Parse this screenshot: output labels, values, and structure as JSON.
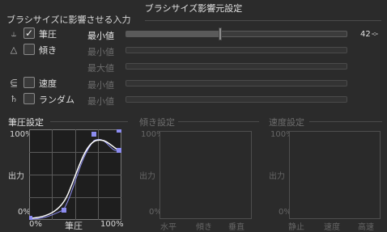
{
  "window_title": "ブラシサイズ影響元設定",
  "section_title": "ブラシサイズに影響させる入力",
  "rows": [
    {
      "icon": "⥿",
      "label": "筆圧",
      "checked": true,
      "param": "最小値",
      "value": "42"
    },
    {
      "icon": "△",
      "label": "傾き",
      "checked": false,
      "param": "最小値"
    },
    {
      "param": "最大値"
    },
    {
      "icon": "⋸",
      "label": "速度",
      "checked": false,
      "param": "最小値"
    },
    {
      "icon": "♄",
      "label": "ランダム",
      "checked": false,
      "param": "最小値"
    }
  ],
  "pressure_panel": {
    "title": "筆圧設定",
    "y_top": "100%",
    "y_mid": "出力",
    "y_bottom": "0%",
    "x_left": "0%",
    "x_mid": "筆圧",
    "x_right": "100%"
  },
  "tilt_panel": {
    "title": "傾き設定",
    "y_top": "100%",
    "y_mid": "出力",
    "y_bottom": "0%",
    "x_labels": [
      "水平",
      "傾き",
      "垂直"
    ]
  },
  "speed_panel": {
    "title": "速度設定",
    "y_top": "100%",
    "y_mid": "出力",
    "y_bottom": "0%",
    "x_labels": [
      "静止",
      "速度",
      "高速"
    ]
  },
  "colors": {
    "background": "#2b2b2b",
    "curve": "#ffffff",
    "control_point": "#8c8cf0"
  },
  "min_value_slider_level": 0.428
}
